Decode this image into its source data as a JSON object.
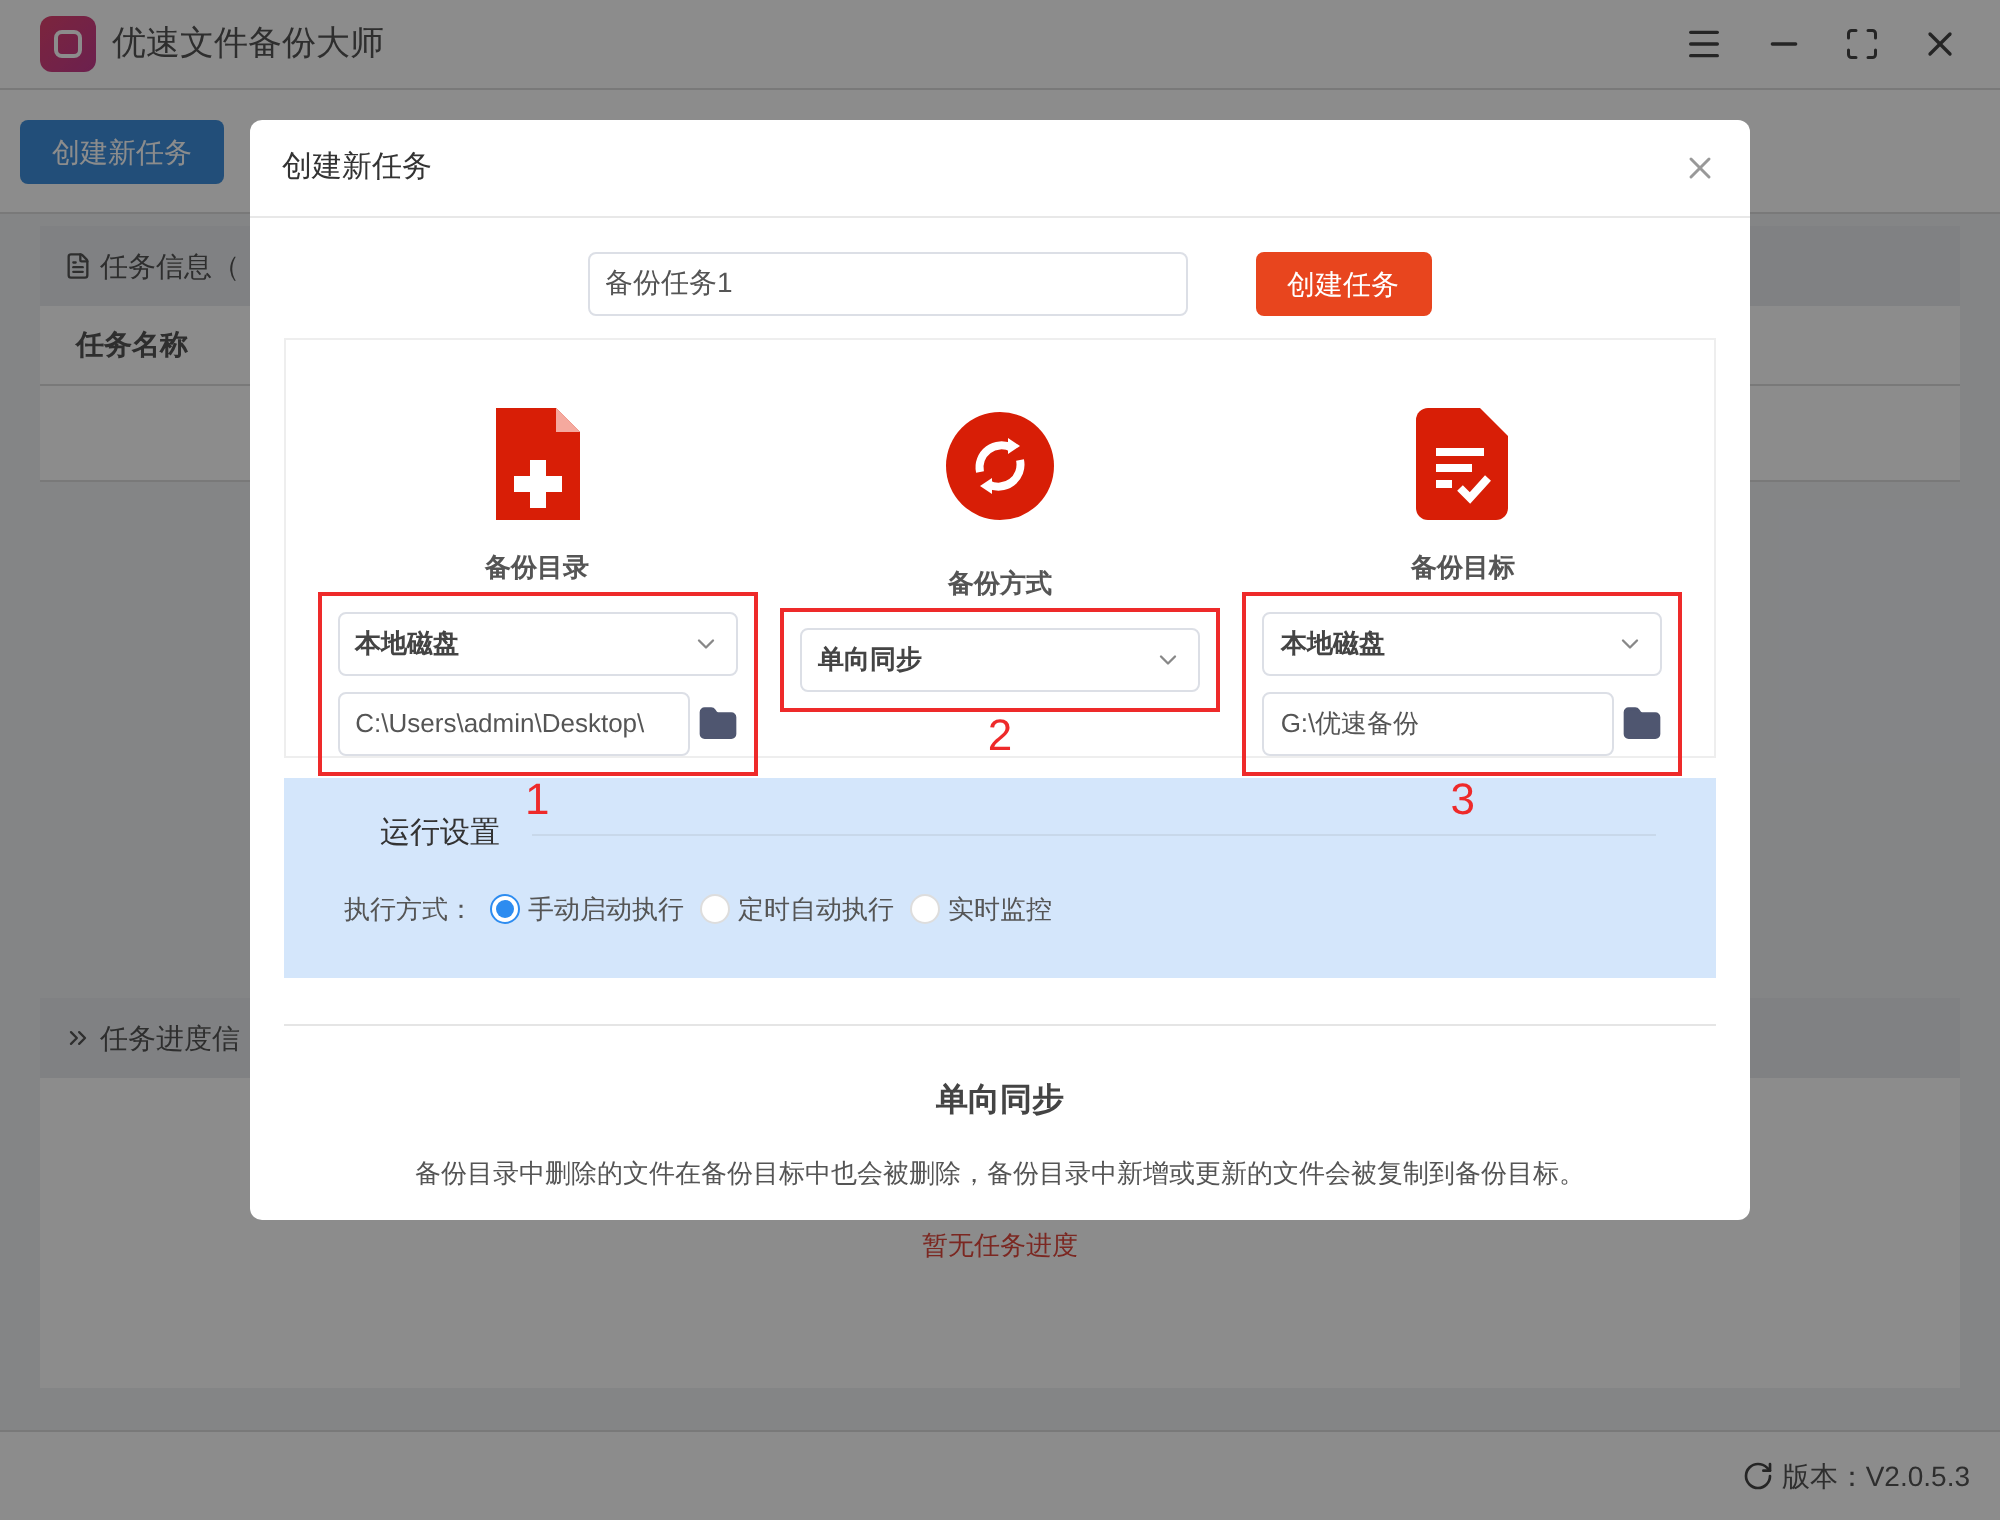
{
  "app": {
    "title": "优速文件备份大师",
    "toolbar_button": "创建新任务",
    "task_panel": {
      "header": "任务信息（",
      "column": "任务名称"
    },
    "progress_panel": {
      "header": "任务进度信",
      "empty_text": "暂无任务进度"
    },
    "version": "版本：V2.0.5.3"
  },
  "dialog": {
    "title": "创建新任务",
    "task_name": "备份任务1",
    "create_button": "创建任务",
    "columns": [
      {
        "kind": "source",
        "label": "备份目录",
        "select": "本地磁盘",
        "path": "C:\\Users\\admin\\Desktop\\",
        "annotation": "1"
      },
      {
        "kind": "mode",
        "label": "备份方式",
        "select": "单向同步",
        "annotation": "2"
      },
      {
        "kind": "target",
        "label": "备份目标",
        "select": "本地磁盘",
        "path": "G:\\优速备份",
        "annotation": "3"
      }
    ],
    "settings": {
      "title": "运行设置",
      "label": "执行方式：",
      "options": [
        {
          "label": "手动启动执行",
          "selected": true
        },
        {
          "label": "定时自动执行",
          "selected": false
        },
        {
          "label": "实时监控",
          "selected": false
        }
      ]
    },
    "summary": {
      "title": "单向同步",
      "text": "备份目录中删除的文件在备份目标中也会被删除，备份目录中新增或更新的文件会被复制到备份目标。"
    }
  }
}
